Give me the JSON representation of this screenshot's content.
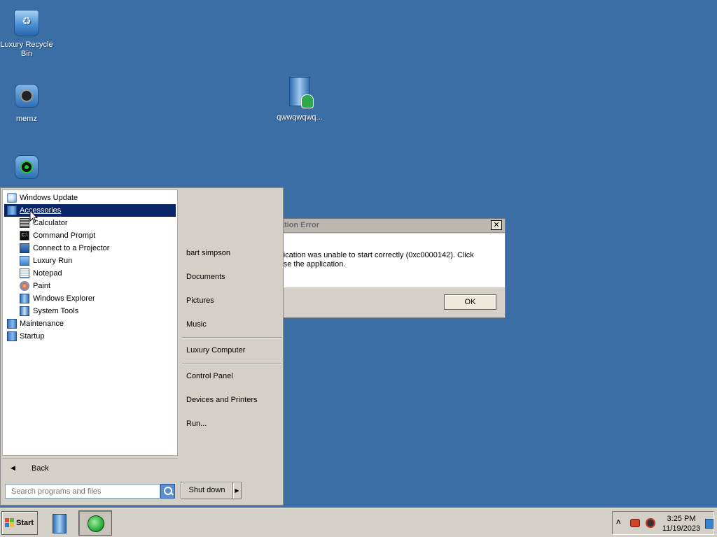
{
  "desktop": {
    "icons": [
      {
        "label": "Luxury Recycle Bin",
        "icon": "recycle-bin-icon"
      },
      {
        "label": "memz",
        "icon": "app-icon"
      },
      {
        "label": "qwwqwqwq...",
        "icon": "user-file-icon"
      },
      {
        "label": "",
        "icon": "app-icon"
      }
    ]
  },
  "dialog": {
    "title": "...tation Error",
    "close_label": "✕",
    "message_line1": "...plication was unable to start correctly (0xc0000142). Click",
    "message_line2": "...lose the application.",
    "ok_label": "OK"
  },
  "start_menu": {
    "programs": [
      {
        "label": "Windows Update",
        "icon": "windows-update-icon",
        "indent": 0
      },
      {
        "label": "Accessories",
        "icon": "folder-icon",
        "indent": 0,
        "selected": true
      },
      {
        "label": "Calculator",
        "icon": "calculator-icon",
        "indent": 1
      },
      {
        "label": "Command Prompt",
        "icon": "command-prompt-icon",
        "indent": 1
      },
      {
        "label": "Connect to a Projector",
        "icon": "projector-icon",
        "indent": 1
      },
      {
        "label": "Luxury Run",
        "icon": "run-icon",
        "indent": 1
      },
      {
        "label": "Notepad",
        "icon": "notepad-icon",
        "indent": 1
      },
      {
        "label": "Paint",
        "icon": "paint-icon",
        "indent": 1
      },
      {
        "label": "Windows Explorer",
        "icon": "explorer-icon",
        "indent": 1
      },
      {
        "label": "System Tools",
        "icon": "folder-icon",
        "indent": 1
      },
      {
        "label": "Maintenance",
        "icon": "folder-icon",
        "indent": 0
      },
      {
        "label": "Startup",
        "icon": "folder-icon",
        "indent": 0
      }
    ],
    "back_label": "Back",
    "search_placeholder": "Search programs and files",
    "right_items": {
      "user": "bart simpson",
      "documents": "Documents",
      "pictures": "Pictures",
      "music": "Music",
      "computer": "Luxury Computer",
      "control_panel": "Control Panel",
      "devices": "Devices and Printers",
      "run": "Run..."
    },
    "shutdown_label": "Shut down",
    "shutdown_arrow": "▶"
  },
  "taskbar": {
    "start_label": "Start",
    "clock_time": "3:25 PM",
    "clock_date": "11/19/2023",
    "tray_chevron": "˄"
  },
  "colors": {
    "desktop_bg": "#3a6ea5",
    "selection": "#0a246a",
    "panel": "#d4d0c8"
  }
}
